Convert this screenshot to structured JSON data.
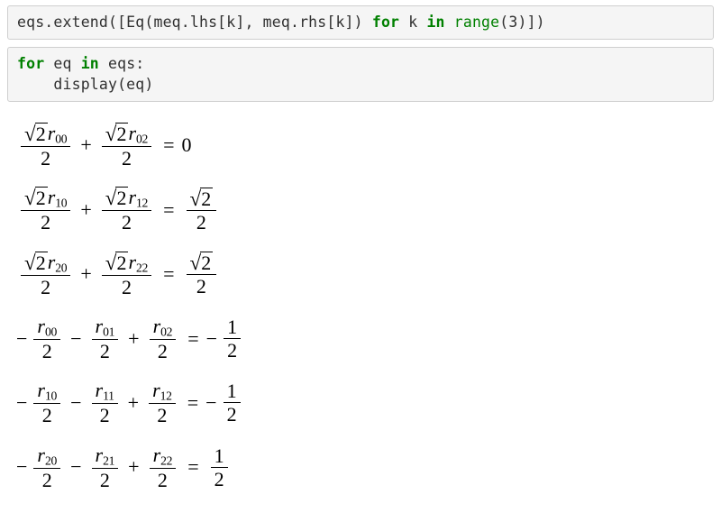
{
  "cells": [
    {
      "tokens": [
        {
          "t": "eqs.extend([Eq(meq.lhs[k], meq.rhs[k]) ",
          "cls": "plain"
        },
        {
          "t": "for",
          "cls": "keyword"
        },
        {
          "t": " k ",
          "cls": "plain"
        },
        {
          "t": "in",
          "cls": "keyword"
        },
        {
          "t": " ",
          "cls": "plain"
        },
        {
          "t": "range",
          "cls": "builtin"
        },
        {
          "t": "(",
          "cls": "plain"
        },
        {
          "t": "3",
          "cls": "plain"
        },
        {
          "t": ")])",
          "cls": "plain"
        }
      ]
    },
    {
      "tokens": [
        {
          "t": "for",
          "cls": "keyword"
        },
        {
          "t": " eq ",
          "cls": "plain"
        },
        {
          "t": "in",
          "cls": "keyword"
        },
        {
          "t": " eqs:\n    display(eq)",
          "cls": "plain"
        }
      ]
    }
  ],
  "equations": [
    {
      "lhs": [
        {
          "sign": "+",
          "num_type": "sqrt_r",
          "sqrt": "2",
          "rsub": "00",
          "den": "2"
        },
        {
          "sign": "+",
          "num_type": "sqrt_r",
          "sqrt": "2",
          "rsub": "02",
          "den": "2"
        }
      ],
      "rhs": {
        "type": "plain",
        "value": "0"
      }
    },
    {
      "lhs": [
        {
          "sign": "+",
          "num_type": "sqrt_r",
          "sqrt": "2",
          "rsub": "10",
          "den": "2"
        },
        {
          "sign": "+",
          "num_type": "sqrt_r",
          "sqrt": "2",
          "rsub": "12",
          "den": "2"
        }
      ],
      "rhs": {
        "type": "sqrt_frac",
        "sqrt": "2",
        "den": "2",
        "sign": "+"
      }
    },
    {
      "lhs": [
        {
          "sign": "+",
          "num_type": "sqrt_r",
          "sqrt": "2",
          "rsub": "20",
          "den": "2"
        },
        {
          "sign": "+",
          "num_type": "sqrt_r",
          "sqrt": "2",
          "rsub": "22",
          "den": "2"
        }
      ],
      "rhs": {
        "type": "sqrt_frac",
        "sqrt": "2",
        "den": "2",
        "sign": "+"
      }
    },
    {
      "lhs": [
        {
          "sign": "-",
          "num_type": "r",
          "rsub": "00",
          "den": "2"
        },
        {
          "sign": "-",
          "num_type": "r",
          "rsub": "01",
          "den": "2"
        },
        {
          "sign": "+",
          "num_type": "r",
          "rsub": "02",
          "den": "2"
        }
      ],
      "rhs": {
        "type": "frac",
        "num": "1",
        "den": "2",
        "sign": "-"
      }
    },
    {
      "lhs": [
        {
          "sign": "-",
          "num_type": "r",
          "rsub": "10",
          "den": "2"
        },
        {
          "sign": "-",
          "num_type": "r",
          "rsub": "11",
          "den": "2"
        },
        {
          "sign": "+",
          "num_type": "r",
          "rsub": "12",
          "den": "2"
        }
      ],
      "rhs": {
        "type": "frac",
        "num": "1",
        "den": "2",
        "sign": "-"
      }
    },
    {
      "lhs": [
        {
          "sign": "-",
          "num_type": "r",
          "rsub": "20",
          "den": "2"
        },
        {
          "sign": "-",
          "num_type": "r",
          "rsub": "21",
          "den": "2"
        },
        {
          "sign": "+",
          "num_type": "r",
          "rsub": "22",
          "den": "2"
        }
      ],
      "rhs": {
        "type": "frac",
        "num": "1",
        "den": "2",
        "sign": "+"
      }
    }
  ]
}
